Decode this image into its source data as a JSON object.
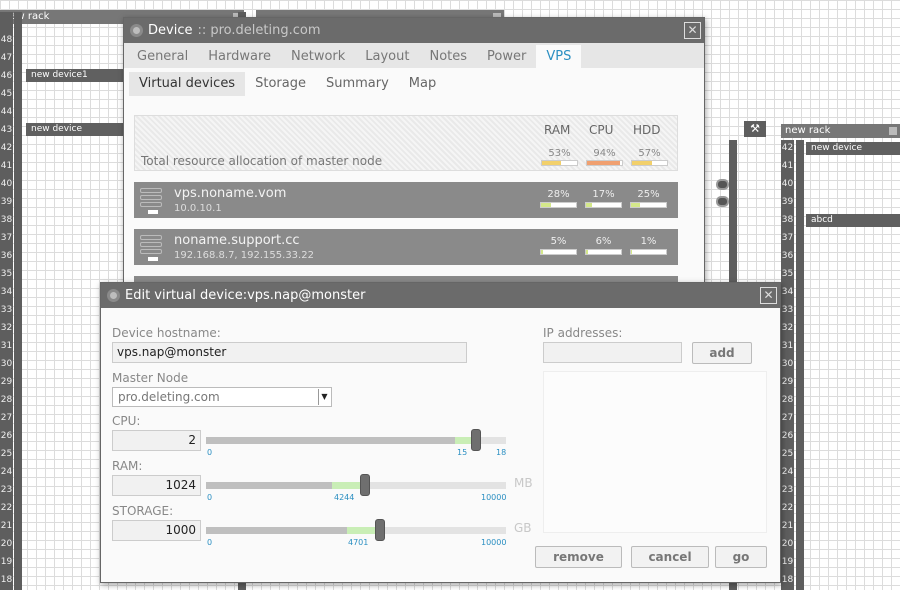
{
  "rack_numbers": [
    "48",
    "47",
    "46",
    "45",
    "44",
    "43",
    "42",
    "41",
    "40",
    "39",
    "38",
    "37",
    "36",
    "35",
    "34",
    "33",
    "32",
    "31",
    "30",
    "29",
    "28",
    "27",
    "26",
    "25",
    "24",
    "23",
    "22",
    "21",
    "20",
    "19",
    "18"
  ],
  "rack_left": {
    "title": "new rack",
    "devices": [
      {
        "label": "new device1"
      },
      {
        "label": "new device"
      }
    ]
  },
  "rack_right": {
    "title": "new rack",
    "devices": [
      {
        "label": "new device"
      },
      {
        "label": "abcd"
      }
    ],
    "numbers": [
      "42",
      "41",
      "40",
      "39",
      "38",
      "37",
      "36",
      "35",
      "34",
      "33",
      "32",
      "31",
      "30",
      "29",
      "28",
      "27",
      "26",
      "25",
      "24",
      "23",
      "22",
      "21",
      "20",
      "19",
      "18"
    ]
  },
  "device_window": {
    "title": "Device",
    "host": ":: pro.deleting.com",
    "tabs": [
      "General",
      "Hardware",
      "Network",
      "Layout",
      "Notes",
      "Power",
      "VPS"
    ],
    "active_tab": "VPS",
    "subtabs": [
      "Virtual devices",
      "Storage",
      "Summary",
      "Map"
    ],
    "resource_headers": [
      "RAM",
      "CPU",
      "HDD"
    ],
    "total_label": "Total resource allocation of master node",
    "total": [
      {
        "pct": "53%",
        "value": 53,
        "color": "#f2d06b"
      },
      {
        "pct": "94%",
        "value": 94,
        "color": "#f0a070"
      },
      {
        "pct": "57%",
        "value": 57,
        "color": "#f2d06b"
      }
    ],
    "vps": [
      {
        "name": "vps.noname.vom",
        "ip": "10.0.10.1",
        "usage": [
          {
            "pct": "28%",
            "value": 28
          },
          {
            "pct": "17%",
            "value": 17
          },
          {
            "pct": "25%",
            "value": 25
          }
        ]
      },
      {
        "name": "noname.support.cc",
        "ip": "192.168.8.7,  192.155.33.22",
        "usage": [
          {
            "pct": "5%",
            "value": 5
          },
          {
            "pct": "6%",
            "value": 6
          },
          {
            "pct": "1%",
            "value": 1
          }
        ]
      }
    ]
  },
  "edit_window": {
    "title": "Edit virtual device:vps.nap@monster",
    "hostname_label": "Device hostname:",
    "hostname_value": "vps.nap@monster",
    "master_label": "Master Node",
    "master_value": "pro.deleting.com",
    "cpu": {
      "label": "CPU:",
      "value": "2",
      "min": "0",
      "mid": "15",
      "max": "18",
      "fraction": 0.9,
      "free": 0.83,
      "unit": ""
    },
    "ram": {
      "label": "RAM:",
      "value": "1024",
      "min": "0",
      "mid": "4244",
      "max": "10000",
      "fraction": 0.53,
      "free": 0.42,
      "unit": "MB"
    },
    "storage": {
      "label": "STORAGE:",
      "value": "1000",
      "min": "0",
      "mid": "4701",
      "max": "10000",
      "fraction": 0.58,
      "free": 0.47,
      "unit": "GB"
    },
    "ip_label": "IP addresses:",
    "ip_value": "",
    "add_label": "add",
    "remove_label": "remove",
    "cancel_label": "cancel",
    "go_label": "go"
  },
  "colors": {
    "accent": "#2b8fc2",
    "bar_ok": "#d4e88a",
    "bar_warn": "#f0a070"
  }
}
